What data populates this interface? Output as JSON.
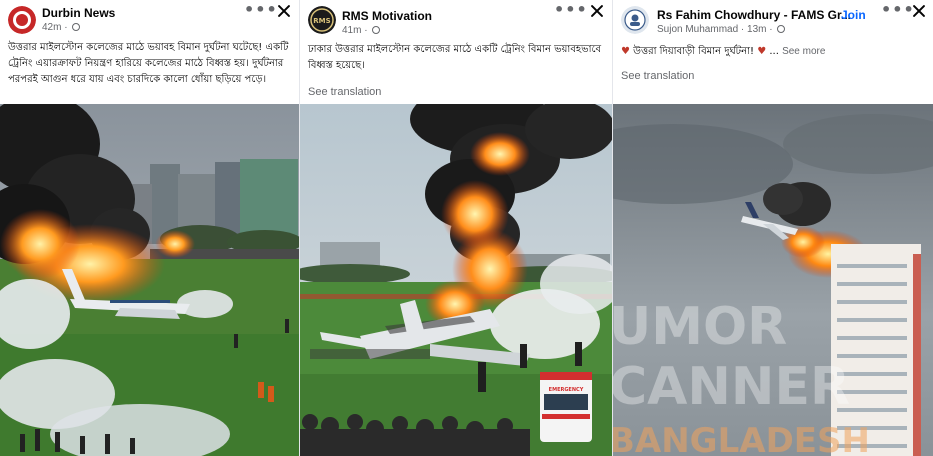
{
  "posts": [
    {
      "author": "Durbin News",
      "time": "42m",
      "caption": "উত্তরার মাইলস্টোন কলেজের মাঠে ভয়াবহ বিমান দুর্ঘটনা ঘটেছে! একটি ট্রেনিং এয়ারক্রাফট নিয়ন্ত্রণ হারিয়ে কলেজের মাঠে বিধ্বস্ত হয়। দুর্ঘটনার পরপরই আগুন ধরে যায় এবং চারদিকে কালো ধোঁয়া ছড়িয়ে পড়ে।",
      "avatar_color": "#c62828"
    },
    {
      "author": "RMS Motivation",
      "time": "41m",
      "caption": "ঢাকার উত্তরার মাইলস্টোন কলেজের মাঠে একটি ট্রেনিং বিমান ভয়াবহভাবে বিধ্বস্ত হয়েছে।",
      "translate": "See translation",
      "avatar_text": "RMS",
      "image_badge": "EMERGENCY"
    },
    {
      "author": "Rs Fahim Chowdhury - FAMS Gr...",
      "join": "Join",
      "sub_author": "Sujon Muhammad",
      "time": "13m",
      "caption": "উত্তরা দিয়াবাড়ী বিমান দুর্ঘটনা!",
      "see_more": "See more",
      "translate": "See translation",
      "watermark": [
        "UMOR",
        "CANNER",
        "BANGLADESH"
      ]
    }
  ],
  "colors": {
    "text_primary": "#050505",
    "text_secondary": "#65676b",
    "link_blue": "#0866ff",
    "fire": "#ff7a1a",
    "smoke": "#1e1e1e",
    "grass": "#3f7a2e"
  },
  "icons": [
    "more-options-icon",
    "close-icon",
    "globe-icon",
    "heart-icon"
  ]
}
